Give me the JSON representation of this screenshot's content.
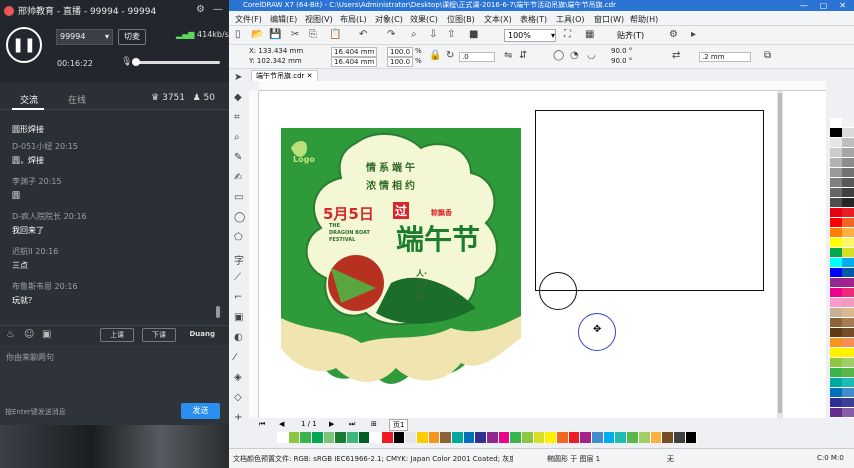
{
  "live": {
    "title": "邢帅教育 - 直播 - 99994 - 99994",
    "room_select": "99994",
    "switch_label": "切麦",
    "bandwidth": "414kb/s",
    "timer": "00:16:22",
    "tab_chat": "交流",
    "tab_online": "在线",
    "count1": "3751",
    "count2": "50",
    "messages": [
      {
        "user": "",
        "text": "圆形焊接"
      },
      {
        "user": "D-051小妞 20:15",
        "text": "圆，焊接"
      },
      {
        "user": "李渊子 20:15",
        "text": "圆"
      },
      {
        "user": "D-疯人院院长 20:16",
        "text": "我回来了"
      },
      {
        "user": "迟航II 20:16",
        "text": "三点"
      },
      {
        "user": "布鲁斯韦恩 20:16",
        "text": "玩就？"
      }
    ],
    "btn_up": "上课",
    "btn_down": "下课",
    "btn_duang": "Duang",
    "input_placeholder": "你由来聊两句",
    "hint": "按Enter键发送消息",
    "send": "发送"
  },
  "cdr": {
    "title": "CorelDRAW X7 (64-Bit) - C:\\Users\\Administrator\\Desktop\\课程\\正式课-2016-6-7\\端午节活动吊旗\\端午节吊旗.cdr",
    "menu": [
      "文件(F)",
      "编辑(E)",
      "视图(V)",
      "布局(L)",
      "对象(C)",
      "效果(C)",
      "位图(B)",
      "文本(X)",
      "表格(T)",
      "工具(O)",
      "窗口(W)",
      "帮助(H)"
    ],
    "zoom": "100%",
    "snap": "贴齐(T)",
    "x": "X: 133.434 mm",
    "y": "Y: 102.342 mm",
    "w": "16.404 mm",
    "h": "16.404 mm",
    "sx": "100.0",
    "sy": "100.0",
    "pct": "%",
    "rot": ".0",
    "angle1": "90.0 °",
    "angle2": "90.0 °",
    "outline": ".2 mm",
    "doc_tab": "端午节吊旗.cdr",
    "page_info": "1 / 1",
    "page_tab": "页1",
    "status_left": "文档颜色预置文件: RGB: sRGB IEC61966-2.1; CMYK: Japan Color 2001 Coated; 灰度: Dot Gain 15%",
    "status_mid": "椭圆形 于 图层 1",
    "status_fill": "无",
    "status_right": "C:0 M:0"
  },
  "artwork": {
    "logo": "Logo",
    "poem": "情系端午 浓情相约",
    "date": "5月5日",
    "guo": "过",
    "sub1": "THE",
    "sub2": "DRAGON BOAT",
    "sub3": "FESTIVAL",
    "big": "端午节",
    "side": "人·团·圆",
    "seal": "粽飘香"
  }
}
